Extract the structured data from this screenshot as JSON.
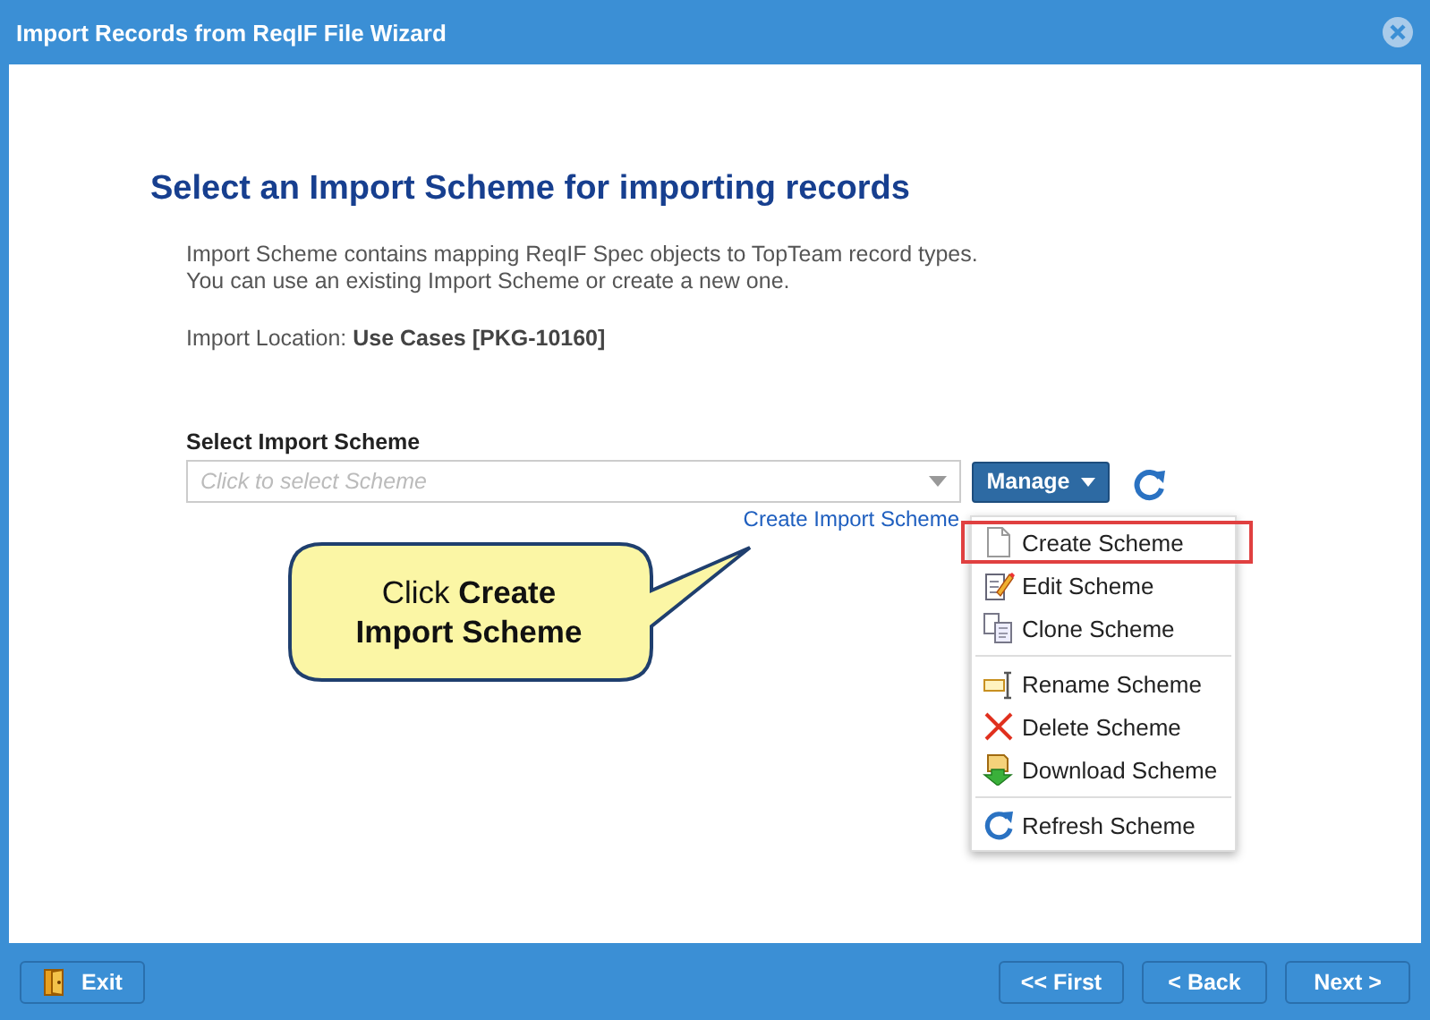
{
  "window": {
    "title": "Import Records from ReqIF File Wizard"
  },
  "heading": "Select an Import Scheme for importing records",
  "description": [
    "Import Scheme contains mapping ReqIF Spec objects to TopTeam record types.",
    "You can use an existing Import Scheme or create a new one."
  ],
  "import_location": {
    "label": "Import Location:",
    "value": "Use Cases [PKG-10160]"
  },
  "scheme_field": {
    "label": "Select Import Scheme",
    "placeholder": "Click to select Scheme"
  },
  "manage_button": "Manage",
  "create_link": "Create Import Scheme",
  "callout": "Click **Create Import Scheme**",
  "menu": {
    "groups": [
      [
        {
          "kind": "create",
          "label": "Create Scheme",
          "highlighted": true
        },
        {
          "kind": "edit",
          "label": "Edit Scheme",
          "highlighted": false
        },
        {
          "kind": "clone",
          "label": "Clone Scheme",
          "highlighted": false
        }
      ],
      [
        {
          "kind": "rename",
          "label": "Rename Scheme",
          "highlighted": false
        },
        {
          "kind": "delete",
          "label": "Delete Scheme",
          "highlighted": false
        },
        {
          "kind": "download",
          "label": "Download Scheme",
          "highlighted": false
        }
      ],
      [
        {
          "kind": "refresh",
          "label": "Refresh Scheme",
          "highlighted": false
        }
      ]
    ]
  },
  "footer": {
    "left": [
      {
        "kind": "exit",
        "label": "Exit"
      }
    ],
    "right": [
      {
        "label": "<< First"
      },
      {
        "label": "< Back"
      },
      {
        "label": "Next >"
      }
    ]
  }
}
